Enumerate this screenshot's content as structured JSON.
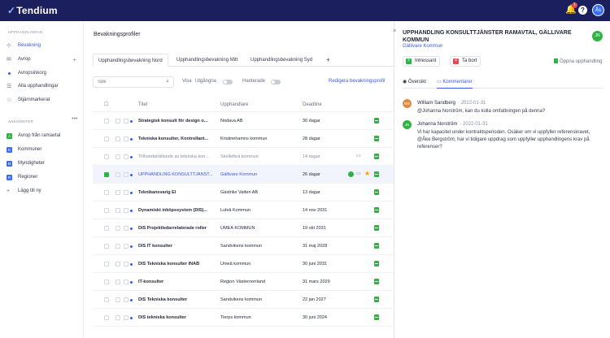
{
  "topbar": {
    "logo": "Tendium",
    "notif_count": "1",
    "avatar_initials": "Ås"
  },
  "sidebar": {
    "section1_title": "UPPHANDLINGAR",
    "items": [
      {
        "label": "Bevakning",
        "active": true
      },
      {
        "label": "Avrop"
      },
      {
        "label": "Avropsinkorg"
      },
      {
        "label": "Alla upphandlingar"
      },
      {
        "label": "Stjärnmarkerat"
      }
    ],
    "section2_title": "ANKOMSTER",
    "items2": [
      {
        "label": "Avrop från ramavtal",
        "badge": "A",
        "color": "#2fb344"
      },
      {
        "label": "Kommuner",
        "badge": "K",
        "color": "#3b6ff5"
      },
      {
        "label": "Myndigheter",
        "badge": "M",
        "color": "#3b6ff5"
      },
      {
        "label": "Regioner",
        "badge": "R",
        "color": "#3b6ff5"
      }
    ],
    "add_label": "Lägg till ny"
  },
  "main": {
    "title": "Bevakningsprofiler",
    "tabs": [
      "Upphandlingsbevakning Nord",
      "Upphandlingsbevakning Mitt",
      "Upphandlingsbevakning Syd"
    ],
    "search_placeholder": "Sök",
    "visa_label": "Visa",
    "utgangna_label": "Utgångna",
    "hanterade_label": "Hanterade",
    "edit_link": "Redigera bevakningsprofil",
    "columns": {
      "title": "Titel",
      "buyer": "Upphandlare",
      "deadline": "Deadline"
    },
    "rows": [
      {
        "title": "Strategisk konsult för design o...",
        "buyer": "Nodava AB",
        "deadline": "30 dagar"
      },
      {
        "title": "Tekniska konsulter, Kontrollant...",
        "buyer": "Kristinehamns kommun",
        "deadline": "28 dagar"
      },
      {
        "title": "Tillhandahållande av tekniska kon...",
        "buyer": "Skellefteå kommun",
        "deadline": "14 dagar"
      },
      {
        "title": "UPPHANDLING KONSULTTJÄNST...",
        "buyer": "Gällivare Kommun",
        "deadline": "26 dagar"
      },
      {
        "title": "Teknikansvarig El",
        "buyer": "Gästrike Vatten AB",
        "deadline": "13 dagar"
      },
      {
        "title": "Dynamiskt inköpssystem (DIS)...",
        "buyer": "Luleå Kommun",
        "deadline": "14 nov 2031"
      },
      {
        "title": "DIS Projektledarrelaterade roller",
        "buyer": "UMEÅ KOMMUN",
        "deadline": "19 okt 2031"
      },
      {
        "title": "DIS IT konsulter",
        "buyer": "Sandvikens kommun",
        "deadline": "31 maj 2028"
      },
      {
        "title": "DIS Tekniska konsulter INAB",
        "buyer": "Umeå kommun",
        "deadline": "30 juni 2031"
      },
      {
        "title": "IT-konsulter",
        "buyer": "Region Västernorrland",
        "deadline": "31 mars 2029"
      },
      {
        "title": "DIS Tekniska konsulter",
        "buyer": "Sandvikens kommun",
        "deadline": "22 jan 2027"
      },
      {
        "title": "DIS tekniska konsulter",
        "buyer": "Tierps kommun",
        "deadline": "30 juni 2024"
      }
    ]
  },
  "panel": {
    "title": "UPPHANDLING KONSULTTJÄNSTER RAMAVTAL, GÄLLIVARE KOMMUN",
    "buyer": "Gällivare Kommun",
    "avatar": "JN",
    "interesting_label": "Intressant",
    "remove_label": "Ta bort",
    "open_label": "Öppna upphandling",
    "tab_overview": "Översikt",
    "tab_comments": "Kommentarer",
    "comments": [
      {
        "initials": "WS",
        "color": "#e08a3c",
        "author": "William Sandberg",
        "date": "2022-01-31",
        "text": "@Johanna Norström, kan du kolla omfattningen på denna?"
      },
      {
        "initials": "JN",
        "color": "#2fb344",
        "author": "Johanna Norström",
        "date": "2022-01-31",
        "text": "Vi har kapacitet under kontraktsperioden. Osäker om vi uppfyller referenskravet, @Åke Bergström, har vi tidigare uppdrag som uppfyller upphandlingens krav på referenser?"
      }
    ]
  }
}
